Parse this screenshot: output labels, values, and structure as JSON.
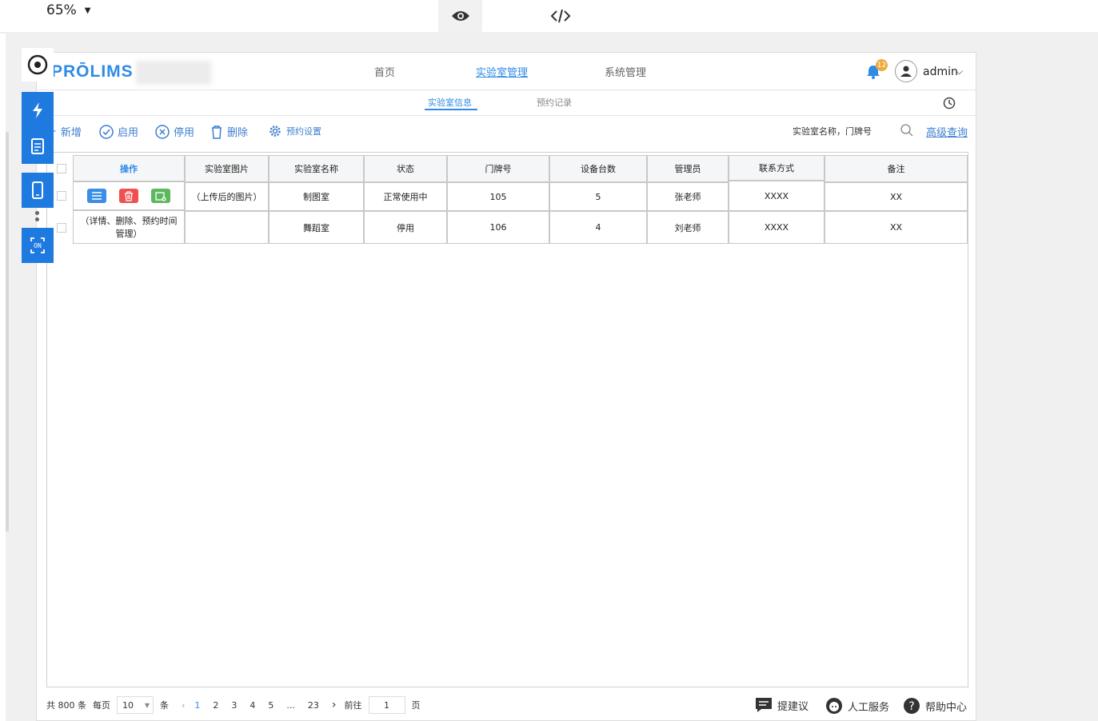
{
  "top_toolbar": {
    "zoom": "65%"
  },
  "brand": {
    "logo_text": "PRŌLIMS"
  },
  "header": {
    "nav": [
      "首页",
      "实验室管理",
      "系统管理"
    ],
    "notification_count": "12",
    "user": "admin"
  },
  "subnav": {
    "tabs": [
      "实验室信息",
      "预约记录"
    ]
  },
  "toolbar": {
    "add": "新增",
    "enable": "启用",
    "disable": "停用",
    "delete": "删除",
    "booking_settings": "预约设置",
    "search_placeholder": "实验室名称，门牌号",
    "advanced_search": "高级查询"
  },
  "table": {
    "headers": [
      "操作",
      "实验室图片",
      "实验室名称",
      "状态",
      "门牌号",
      "设备台数",
      "管理员",
      "联系方式",
      "备注"
    ],
    "op_note": "（详情、删除、预约时间管理）",
    "rows": [
      {
        "image": "（上传后的图片）",
        "name": "制图室",
        "status": "正常使用中",
        "door": "105",
        "devices": "5",
        "admin": "张老师",
        "contact": "XXXX",
        "note": "XX"
      },
      {
        "image": "",
        "name": "舞蹈室",
        "status": "停用",
        "door": "106",
        "devices": "4",
        "admin": "刘老师",
        "contact": "XXXX",
        "note": "XX"
      }
    ]
  },
  "pagination": {
    "total": "共 800 条",
    "per_page_label": "每页",
    "per_page": "10",
    "unit": "条",
    "pages": [
      "1",
      "2",
      "3",
      "4",
      "5",
      "...",
      "23"
    ],
    "goto_label": "前往",
    "goto_value": "1",
    "page_unit": "页"
  },
  "footer": {
    "suggest": "提建议",
    "service": "人工服务",
    "help": "帮助中心"
  },
  "colors": {
    "accent": "#2f8be6",
    "side_button": "#1f7ae0",
    "danger": "#f05050",
    "success": "#5cb85c",
    "badge": "#f0a93a"
  }
}
